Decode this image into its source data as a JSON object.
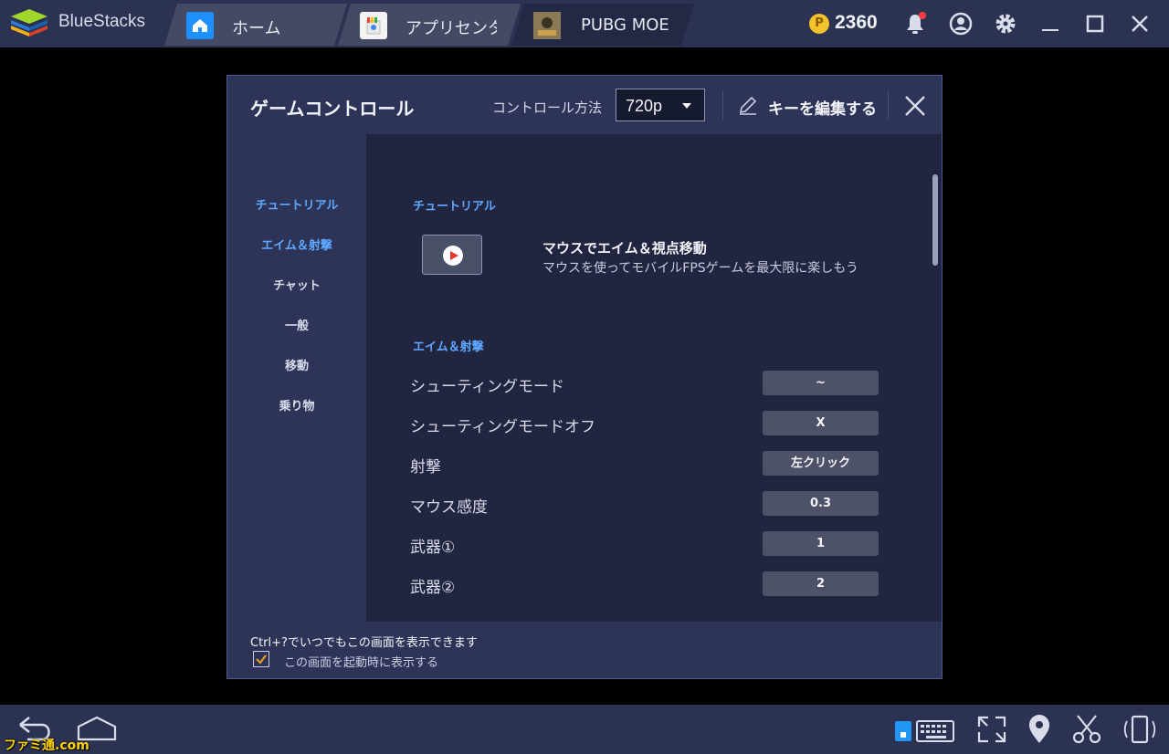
{
  "titlebar": {
    "app_name": "BlueStacks",
    "tabs": [
      {
        "label": "ホーム",
        "icon": "home-icon"
      },
      {
        "label": "アプリセンタ-",
        "icon": "app-center-icon"
      },
      {
        "label": "PUBG MOE",
        "icon": "pubg-icon",
        "active": true
      }
    ],
    "coins": "2360",
    "icons": [
      "bell-icon",
      "account-icon",
      "gear-icon",
      "minimize-icon",
      "maximize-icon",
      "close-icon"
    ]
  },
  "modal": {
    "title": "ゲームコントロール",
    "method_label": "コントロール方法",
    "method_value": "720p",
    "edit_label": "キーを編集する",
    "sidebar": [
      {
        "label": "チュートリアル",
        "active": true
      },
      {
        "label": "エイム＆射撃",
        "active": true
      },
      {
        "label": "チャット"
      },
      {
        "label": "一般"
      },
      {
        "label": "移動"
      },
      {
        "label": "乗り物"
      }
    ],
    "tutorial": {
      "section": "チュートリアル",
      "title": "マウスでエイム＆視点移動",
      "subtitle": "マウスを使ってモバイルFPSゲームを最大限に楽しもう"
    },
    "aim": {
      "section": "エイム＆射撃",
      "rows": [
        {
          "label": "シューティングモード",
          "key": "~"
        },
        {
          "label": "シューティングモードオフ",
          "key": "X"
        },
        {
          "label": "射撃",
          "key": "左クリック"
        },
        {
          "label": "マウス感度",
          "key": "0.3"
        },
        {
          "label": "武器①",
          "key": "1"
        },
        {
          "label": "武器②",
          "key": "2"
        }
      ]
    },
    "footer": {
      "text": "Ctrl+?でいつでもこの画面を表示できます",
      "checkbox_label": "この画面を起動時に表示する",
      "checked": true
    }
  },
  "watermark": "ファミ通.com",
  "colors": {
    "accent": "#5ea8ff",
    "titlebar": "#2c3252",
    "panel": "#2e3458",
    "content": "#222540"
  }
}
